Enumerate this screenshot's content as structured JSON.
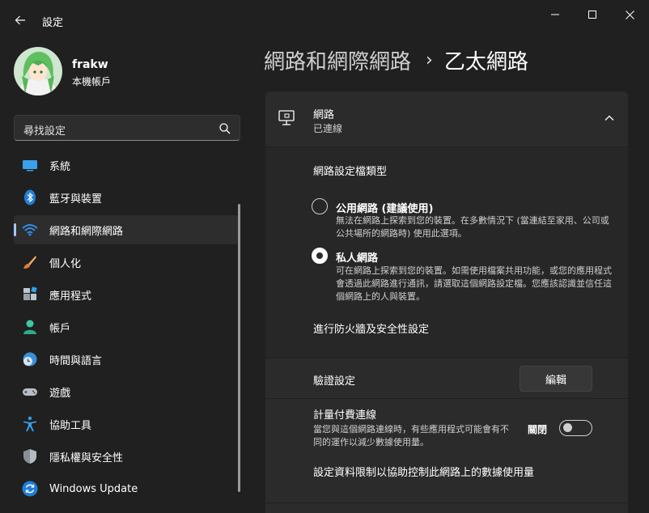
{
  "window": {
    "title": "設定"
  },
  "profile": {
    "name": "frakw",
    "account_type": "本機帳戶"
  },
  "search": {
    "placeholder": "尋找設定"
  },
  "sidebar": {
    "items": [
      {
        "label": "系統",
        "icon": "monitor-icon"
      },
      {
        "label": "藍牙與裝置",
        "icon": "bluetooth-icon"
      },
      {
        "label": "網路和網際網路",
        "icon": "wifi-icon",
        "selected": true
      },
      {
        "label": "個人化",
        "icon": "brush-icon"
      },
      {
        "label": "應用程式",
        "icon": "apps-icon"
      },
      {
        "label": "帳戶",
        "icon": "person-icon"
      },
      {
        "label": "時間與語言",
        "icon": "globe-clock-icon"
      },
      {
        "label": "遊戲",
        "icon": "gamepad-icon"
      },
      {
        "label": "協助工具",
        "icon": "accessibility-icon"
      },
      {
        "label": "隱私權與安全性",
        "icon": "shield-icon"
      },
      {
        "label": "Windows Update",
        "icon": "update-icon"
      }
    ]
  },
  "breadcrumb": {
    "parent": "網路和網際網路",
    "separator": "›",
    "current": "乙太網路"
  },
  "network": {
    "name": "網路",
    "status": "已連線",
    "profile_type_title": "網路設定檔類型",
    "options": [
      {
        "title": "公用網路 (建議使用)",
        "desc": "無法在網路上探索到您的裝置。在多數情況下 (當連結至家用、公司或公共場所的網路時) 使用此選項。",
        "checked": false
      },
      {
        "title": "私人網路",
        "desc": "可在網路上探索到您的裝置。如需使用檔案共用功能，或您的應用程式會透過此網路進行通訊，請選取這個網路設定檔。您應該認識並信任這個網路上的人與裝置。",
        "checked": true
      }
    ],
    "firewall_link": "進行防火牆及安全性設定"
  },
  "auth": {
    "label": "驗證設定",
    "button": "編輯"
  },
  "metered": {
    "title": "計量付費連線",
    "desc": "當您與這個網路連線時，有些應用程式可能會有不同的運作以減少數據使用量。",
    "toggle_label": "關閉",
    "toggle_on": false,
    "data_limit_text": "設定資料限制以協助控制此網路上的數據使用量"
  },
  "colors": {
    "background": "#202020",
    "card": "#2b2b2b",
    "accent": "#a0c8ff"
  }
}
